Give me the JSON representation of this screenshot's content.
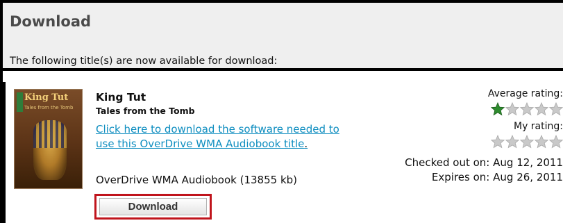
{
  "header": {
    "title": "Download",
    "message": "The following title(s) are now available for download:"
  },
  "item": {
    "cover": {
      "title": "King Tut",
      "subtitle": "Tales from the Tomb"
    },
    "title": "King Tut",
    "subtitle": "Tales from the Tomb",
    "software_link": "Click here to download the software needed to use this OverDrive WMA Audiobook title",
    "link_period": ".",
    "format": "OverDrive WMA Audiobook (13855 kb)",
    "download_button": "Download",
    "average_rating_label": "Average rating:",
    "average_rating_value": 1,
    "my_rating_label": "My rating:",
    "my_rating_value": 0,
    "checked_out_label": "Checked out on:",
    "checked_out_date": "Aug 12, 2011",
    "expires_label": "Expires on:",
    "expires_date": "Aug 26, 2011"
  },
  "colors": {
    "link": "#0f8ec0",
    "highlight_border": "#c0141c",
    "star_filled": "#2e8b2e",
    "star_empty": "#c9c9c9"
  }
}
